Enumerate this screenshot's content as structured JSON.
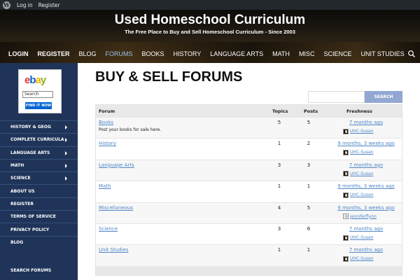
{
  "admin_bar": {
    "login": "Log in",
    "register": "Register"
  },
  "site": {
    "title": "Used Homeschool Curriculum",
    "tagline": "The Free Place to Buy and Sell Homeschool Curriculum - Since 2003"
  },
  "nav": {
    "items": [
      {
        "label": "LOGIN"
      },
      {
        "label": "REGISTER"
      },
      {
        "label": "BLOG"
      },
      {
        "label": "FORUMS"
      },
      {
        "label": "BOOKS"
      },
      {
        "label": "HISTORY"
      },
      {
        "label": "LANGUAGE ARTS"
      },
      {
        "label": "MATH"
      },
      {
        "label": "MISC"
      },
      {
        "label": "SCIENCE"
      },
      {
        "label": "UNIT STUDIES"
      }
    ]
  },
  "ebay": {
    "logo_e": "e",
    "logo_b": "b",
    "logo_a": "a",
    "logo_y": "y",
    "search_value": "Search",
    "button": "FIND IT NOW"
  },
  "sidebar": {
    "items": [
      {
        "label": "HISTORY & GEOG"
      },
      {
        "label": "COMPLETE CURRICULA"
      },
      {
        "label": "LANGUAGE ARTS"
      },
      {
        "label": "MATH"
      },
      {
        "label": "SCIENCE"
      },
      {
        "label": "ABOUT US"
      },
      {
        "label": "REGISTER"
      },
      {
        "label": "TERMS OF SERVICE"
      },
      {
        "label": "PRIVACY POLICY"
      },
      {
        "label": "BLOG"
      }
    ],
    "heading": "SEARCH FORUMS"
  },
  "main": {
    "title": "BUY & SELL FORUMS",
    "search_button": "SEARCH"
  },
  "table": {
    "headers": {
      "forum": "Forum",
      "topics": "Topics",
      "posts": "Posts",
      "freshness": "Freshness"
    },
    "rows": [
      {
        "name": "Books",
        "desc": "Post your books for sale here.",
        "topics": "5",
        "posts": "5",
        "freshness": "7 months ago",
        "author": "UHC-Susan"
      },
      {
        "name": "History",
        "desc": "",
        "topics": "1",
        "posts": "2",
        "freshness": "9 months, 3 weeks ago",
        "author": "UHC-Susan"
      },
      {
        "name": "Language Arts",
        "desc": "",
        "topics": "3",
        "posts": "3",
        "freshness": "7 months ago",
        "author": "UHC-Susan"
      },
      {
        "name": "Math",
        "desc": "",
        "topics": "1",
        "posts": "1",
        "freshness": "9 months, 3 weeks ago",
        "author": "UHC-Susan"
      },
      {
        "name": "Miscellaneous",
        "desc": "",
        "topics": "4",
        "posts": "5",
        "freshness": "9 months, 3 weeks ago",
        "author": "jenniferflynn"
      },
      {
        "name": "Science",
        "desc": "",
        "topics": "3",
        "posts": "6",
        "freshness": "7 months ago",
        "author": "UHC-Susan"
      },
      {
        "name": "Unit Studies",
        "desc": "",
        "topics": "1",
        "posts": "1",
        "freshness": "7 months ago",
        "author": "UHC-Susan"
      }
    ]
  }
}
